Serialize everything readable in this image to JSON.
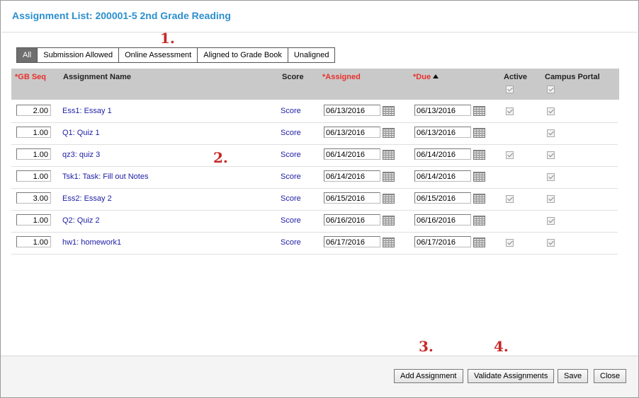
{
  "window": {
    "title": "Assignment List: 200001-5 2nd Grade Reading"
  },
  "filters": [
    {
      "label": "All",
      "active": true
    },
    {
      "label": "Submission Allowed",
      "active": false
    },
    {
      "label": "Online Assessment",
      "active": false
    },
    {
      "label": "Aligned to Grade Book",
      "active": false
    },
    {
      "label": "Unaligned",
      "active": false
    }
  ],
  "markers": [
    "1.",
    "2.",
    "3.",
    "4."
  ],
  "columns": {
    "gb_seq": "*GB Seq",
    "name": "Assignment Name",
    "score": "Score",
    "assigned": "*Assigned",
    "due": "*Due",
    "active": "Active",
    "portal": "Campus Portal",
    "sort_column": "due",
    "sort_direction": "ascending"
  },
  "header_checkboxes": {
    "active": true,
    "portal": true
  },
  "rows": [
    {
      "seq": "2.00",
      "name": "Ess1: Essay 1",
      "score": "Score",
      "assigned": "06/13/2016",
      "due": "06/13/2016",
      "active": true,
      "portal": true
    },
    {
      "seq": "1.00",
      "name": "Q1: Quiz 1",
      "score": "Score",
      "assigned": "06/13/2016",
      "due": "06/13/2016",
      "active": false,
      "portal": true
    },
    {
      "seq": "1.00",
      "name": "qz3: quiz 3",
      "score": "Score",
      "assigned": "06/14/2016",
      "due": "06/14/2016",
      "active": true,
      "portal": true
    },
    {
      "seq": "1.00",
      "name": "Tsk1: Task: Fill out Notes",
      "score": "Score",
      "assigned": "06/14/2016",
      "due": "06/14/2016",
      "active": false,
      "portal": true
    },
    {
      "seq": "3.00",
      "name": "Ess2: Essay 2",
      "score": "Score",
      "assigned": "06/15/2016",
      "due": "06/15/2016",
      "active": true,
      "portal": true
    },
    {
      "seq": "1.00",
      "name": "Q2: Quiz 2",
      "score": "Score",
      "assigned": "06/16/2016",
      "due": "06/16/2016",
      "active": false,
      "portal": true
    },
    {
      "seq": "1.00",
      "name": "hw1: homework1",
      "score": "Score",
      "assigned": "06/17/2016",
      "due": "06/17/2016",
      "active": true,
      "portal": true
    }
  ],
  "footer": {
    "add_label": "Add Assignment",
    "validate_label": "Validate Assignments",
    "save_label": "Save",
    "close_label": "Close"
  },
  "colors": {
    "title": "#2b8fce",
    "required": "#e8302b",
    "link": "#1c1ca6",
    "marker": "#c62828"
  }
}
